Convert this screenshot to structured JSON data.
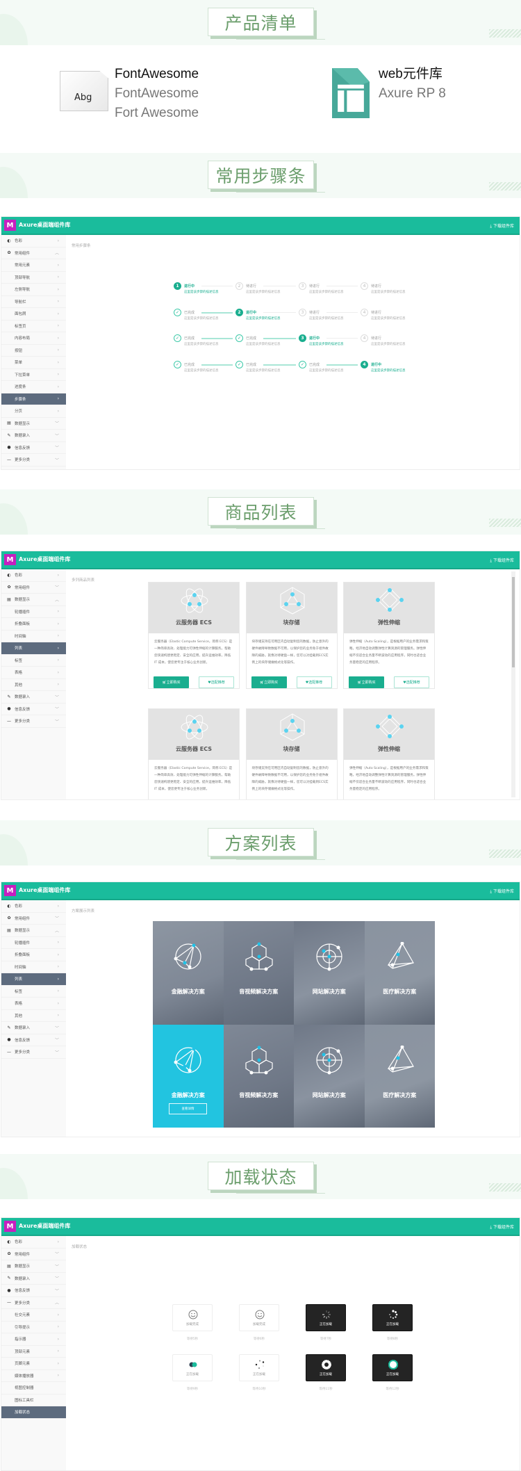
{
  "sections": {
    "products": "产品清单",
    "steps": "常用步骤条",
    "goods": "商品列表",
    "solutions": "方案列表",
    "loading": "加载状态"
  },
  "products": [
    {
      "icon": "font-file-icon",
      "preview": "Abg",
      "name": "FontAwesome",
      "lines": [
        "FontAwesome",
        "Fort Awesome"
      ]
    },
    {
      "icon": "axure-icon",
      "name": "web元件库",
      "lines": [
        "Axure RP 8"
      ]
    }
  ],
  "app": {
    "logo": "M",
    "title": "Axure桌面端组件库",
    "download": "下载组件库",
    "accent": "#1abc9c"
  },
  "panel_steps": {
    "crumb": "常用步骤条",
    "sidebar": [
      {
        "icon": "palette-icon",
        "label": "色彩"
      },
      {
        "icon": "gear-icon",
        "label": "常用组件",
        "chev": "up"
      },
      {
        "label": "常用元素",
        "sub": true
      },
      {
        "label": "顶部导航",
        "sub": true
      },
      {
        "label": "左侧导航",
        "sub": true
      },
      {
        "label": "导航栏",
        "sub": true
      },
      {
        "label": "面包屑",
        "sub": true
      },
      {
        "label": "标签页",
        "sub": true
      },
      {
        "label": "内容布局",
        "sub": true
      },
      {
        "label": "按钮",
        "sub": true
      },
      {
        "label": "菜单",
        "sub": true
      },
      {
        "label": "下拉菜单",
        "sub": true
      },
      {
        "label": "进度条",
        "sub": true
      },
      {
        "label": "步骤条",
        "sub": true,
        "active": true
      },
      {
        "label": "分页",
        "sub": true
      },
      {
        "icon": "database-icon",
        "label": "数据显示",
        "chev": "down"
      },
      {
        "icon": "edit-icon",
        "label": "数据录入",
        "chev": "down"
      },
      {
        "icon": "comment-icon",
        "label": "信息反馈",
        "chev": "down"
      },
      {
        "icon": "minus-icon",
        "label": "更多分类",
        "chev": "down"
      }
    ],
    "labels": {
      "run": "进行中",
      "wait": "待进行",
      "done": "已完成"
    },
    "desc": "这里是该步骤的描述信息",
    "rows": [
      1,
      2,
      3,
      4
    ]
  },
  "panel_goods": {
    "crumb": "多列商品列表",
    "sidebar": [
      {
        "icon": "palette-icon",
        "label": "色彩"
      },
      {
        "icon": "gear-icon",
        "label": "常用组件",
        "chev": "down"
      },
      {
        "icon": "database-icon",
        "label": "数据显示",
        "chev": "up"
      },
      {
        "label": "轮播插件",
        "sub": true
      },
      {
        "label": "折叠面板",
        "sub": true
      },
      {
        "label": "时间轴",
        "sub": true
      },
      {
        "label": "列表",
        "sub": true,
        "active": true
      },
      {
        "label": "标签",
        "sub": true
      },
      {
        "label": "表格",
        "sub": true
      },
      {
        "label": "其他",
        "sub": true
      },
      {
        "icon": "edit-icon",
        "label": "数据录入",
        "chev": "down"
      },
      {
        "icon": "comment-icon",
        "label": "信息反馈",
        "chev": "down"
      },
      {
        "icon": "minus-icon",
        "label": "更多分类",
        "chev": "down"
      }
    ],
    "cards": [
      {
        "icon": "atom-icon",
        "title": "云服务器 ECS",
        "desc": "云服务器（Elastic Compute Service，简称 ECS）是一种简单高效、处理能力可弹性伸缩的计算服务。帮助您快速构建更稳定、安全的应用，提升运维效率，降低 IT 成本，使您更专注于核心业务创新。"
      },
      {
        "icon": "cube-icon",
        "title": "块存储",
        "desc": "块存储支持在可用区内自动复制您的数据，防止意外的硬件故障导致数据不可用，以保护您的业务免于组件故障的威胁。就像对待硬盘一样，您可以对挂载到ECS实例上的块存储做格式化等操作。"
      },
      {
        "icon": "scaling-icon",
        "title": "弹性伸缩",
        "desc": "弹性伸缩（Auto Scaling），是根据用户的业务需求和策略，经济地自动调整弹性计算资源的管理服务。弹性伸缩不仅适合业务量不断波动的应用程序，同时也适合业务量稳定的应用程序。"
      }
    ],
    "buy": "立即购买",
    "recommend": "选配推荐"
  },
  "panel_solutions": {
    "crumb": "方案展示列表",
    "tiles": [
      "金融解决方案",
      "音视频解决方案",
      "网站解决方案",
      "医疗解决方案"
    ],
    "detail": "查看详情",
    "highlight": "#22c4e0"
  },
  "panel_loading": {
    "crumb": "加载状态",
    "sidebar": [
      {
        "icon": "palette-icon",
        "label": "色彩"
      },
      {
        "icon": "gear-icon",
        "label": "常用组件",
        "chev": "down"
      },
      {
        "icon": "database-icon",
        "label": "数据显示",
        "chev": "down"
      },
      {
        "icon": "edit-icon",
        "label": "数据录入",
        "chev": "down"
      },
      {
        "icon": "comment-icon",
        "label": "信息反馈",
        "chev": "down"
      },
      {
        "icon": "minus-icon",
        "label": "更多分类",
        "chev": "up"
      },
      {
        "label": "社交元素",
        "sub": true
      },
      {
        "label": "引导提示",
        "sub": true
      },
      {
        "label": "指示器",
        "sub": true
      },
      {
        "label": "顶部元素",
        "sub": true
      },
      {
        "label": "页脚元素",
        "sub": true
      },
      {
        "label": "媒体播放器",
        "sub": true
      },
      {
        "label": "视图控制器",
        "sub": true,
        "nochev": true
      },
      {
        "label": "图标工具栏",
        "sub": true,
        "nochev": true
      },
      {
        "label": "加载状态",
        "sub": true,
        "active": true,
        "nochev": true
      }
    ],
    "loaders": [
      {
        "icon": "smile-icon",
        "text": "加载完成",
        "caption": "等待5秒",
        "dark": false
      },
      {
        "icon": "smile-icon",
        "text": "加载完成",
        "caption": "等待6秒",
        "dark": false
      },
      {
        "icon": "spinner-lines-icon",
        "text": "正在加载",
        "caption": "等待7秒",
        "dark": true
      },
      {
        "icon": "spinner-dots-icon",
        "text": "正在加载",
        "caption": "等待8秒",
        "dark": true
      },
      {
        "icon": "toggle-dots-icon",
        "text": "正在加载",
        "caption": "等待9秒",
        "dark": false
      },
      {
        "icon": "scatter-dots-icon",
        "text": "正在加载",
        "caption": "等待10秒",
        "dark": false
      },
      {
        "icon": "gear-ring-icon",
        "text": "正在加载",
        "caption": "等待11秒",
        "dark": true
      },
      {
        "icon": "badge-icon",
        "text": "正在加载",
        "caption": "等待12秒",
        "dark": true
      }
    ]
  }
}
